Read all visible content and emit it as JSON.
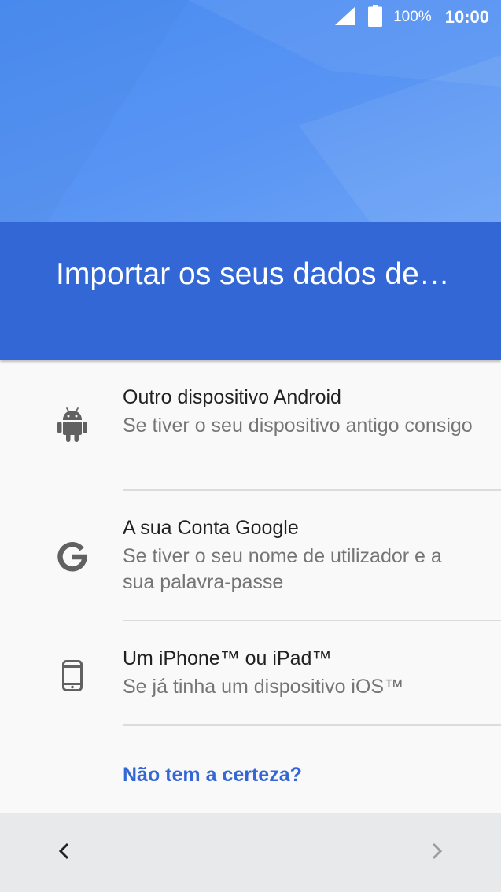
{
  "status_bar": {
    "battery_percent": "100%",
    "time": "10:00"
  },
  "header": {
    "title": "Importar os seus dados de…"
  },
  "options": [
    {
      "title": "Outro dispositivo Android",
      "subtitle": "Se tiver o seu dispositivo antigo consigo",
      "icon": "android-icon"
    },
    {
      "title": "A sua Conta Google",
      "subtitle": "Se tiver o seu nome de utilizador e a sua palavra-passe",
      "icon": "google-g-icon"
    },
    {
      "title": "Um iPhone™ ou iPad™",
      "subtitle": "Se já tinha um dispositivo iOS™",
      "icon": "phone-icon"
    }
  ],
  "help_link": "Não tem a certeza?",
  "navigation": {
    "back_icon": "chevron-left-icon",
    "next_icon": "chevron-right-icon"
  },
  "colors": {
    "accent": "#3367d6",
    "header_light": "#5894f3",
    "next_disabled": "#9e9e9e"
  }
}
